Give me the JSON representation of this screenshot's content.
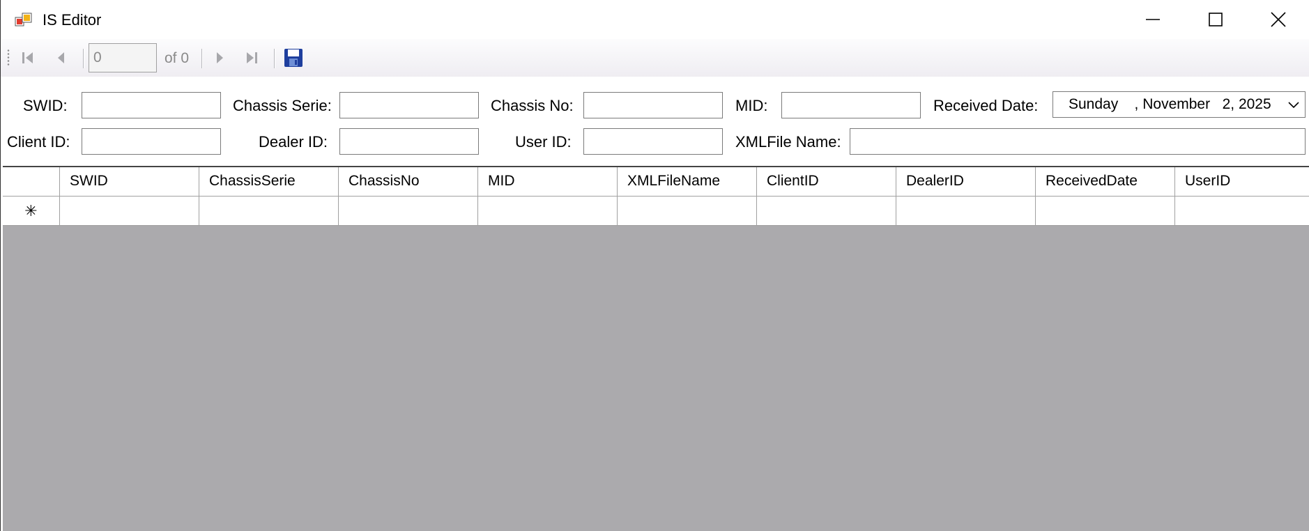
{
  "window": {
    "title": "IS Editor"
  },
  "navigator": {
    "position": "0",
    "count_label": "of 0"
  },
  "form": {
    "swid_label": "SWID:",
    "chassis_serie_label": "Chassis Serie:",
    "chassis_no_label": "Chassis No:",
    "mid_label": "MID:",
    "received_date_label": "Received Date:",
    "received_date_value": "Sunday    , November   2, 2025",
    "client_id_label": "Client ID:",
    "dealer_id_label": "Dealer ID:",
    "user_id_label": "User ID:",
    "xml_file_name_label": "XMLFile Name:",
    "swid_value": "",
    "chassis_serie_value": "",
    "chassis_no_value": "",
    "mid_value": "",
    "client_id_value": "",
    "dealer_id_value": "",
    "user_id_value": "",
    "xml_file_name_value": ""
  },
  "grid": {
    "columns": [
      "SWID",
      "ChassisSerie",
      "ChassisNo",
      "MID",
      "XMLFileName",
      "ClientID",
      "DealerID",
      "ReceivedDate",
      "UserID"
    ],
    "new_row_marker": "✳",
    "rows": []
  },
  "colors": {
    "grid_background": "#abaaad",
    "toolbar_gradient_top": "#fcfcfd",
    "toolbar_gradient_bottom": "#efedf2",
    "field_border": "#7a7a7a"
  }
}
